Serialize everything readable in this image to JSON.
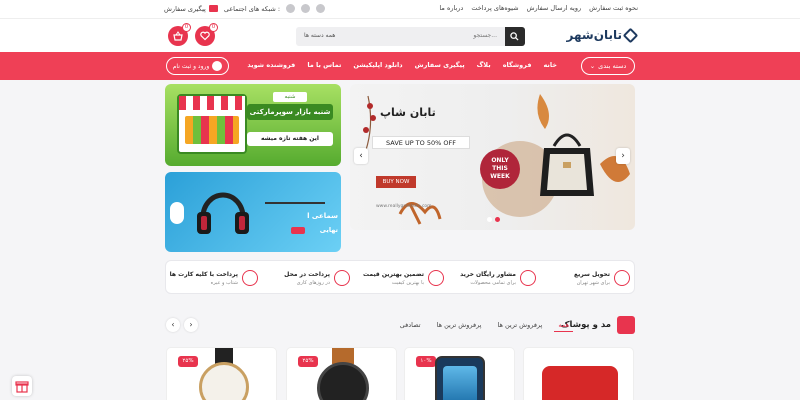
{
  "colors": {
    "brand": "#ef4056",
    "accent": "#e8344e",
    "logo": "#1e3a5f"
  },
  "topbar": {
    "links": [
      "نحوه ثبت سفارش",
      "رویه ارسال سفارش",
      "شیوه‌های پرداخت",
      "درباره ما"
    ],
    "social_label": "شبکه های اجتماعی :",
    "track_label": "پیگیری سفارش",
    "social_icons": [
      "instagram-icon",
      "twitter-icon",
      "facebook-icon"
    ]
  },
  "header": {
    "logo_text": "تابان‌شهر",
    "search_placeholder": "جستجو...",
    "search_category": "همه دسته ها",
    "cart_count": "0",
    "wishlist_count": "0"
  },
  "nav": {
    "category_button": "دسته بندی",
    "items": [
      "خانه",
      "فروشگاه",
      "بلاگ",
      "پیگیری سفارش",
      "دانلود اپلیکیشن",
      "تماس با ما",
      "فروشنده شوید"
    ],
    "login": "ورود و ثبت نام"
  },
  "banners": {
    "b1_title": "شنبه بازار سوپرمارکتی",
    "b1_sub": "این هفته تازه میشه",
    "b1_tag": "شنبه",
    "b2_title": "سماعی ا",
    "b2_sub": "تهایی"
  },
  "slider": {
    "brand": "تابان شاپ",
    "offer": "SAVE UP TO 50% OFF",
    "cta": "BUY NOW",
    "badge_line1": "ONLY",
    "badge_line2": "THIS",
    "badge_line3": "WEEK",
    "url": "www.reallygreatsite.com"
  },
  "features": [
    {
      "title": "تحویل سریع",
      "sub": "برای شهر تهران",
      "icon": "delivery-icon"
    },
    {
      "title": "مشاور رایگان خرید",
      "sub": "برای تمامی محصولات",
      "icon": "headset-icon"
    },
    {
      "title": "تضمین بهترین قیمت",
      "sub": "با بهترین کیفیت",
      "icon": "price-tag-icon"
    },
    {
      "title": "پرداخت در محل",
      "sub": "در روزهای کاری",
      "icon": "truck-icon"
    },
    {
      "title": "پرداخت با کلیه کارت ها",
      "sub": "شتاب و عیره",
      "icon": "card-icon"
    }
  ],
  "section": {
    "title": "مد و پوشاک",
    "tabs": [
      "همه",
      "پرفروش ترین ها",
      "پرفروش ترین ها",
      "تصادفی"
    ]
  },
  "products": [
    {
      "discount": "",
      "kind": "wallet"
    },
    {
      "discount": "۱۰%",
      "kind": "phone"
    },
    {
      "discount": "۲۵%",
      "kind": "watch-dark"
    },
    {
      "discount": "۲۵%",
      "kind": "watch-light"
    }
  ]
}
